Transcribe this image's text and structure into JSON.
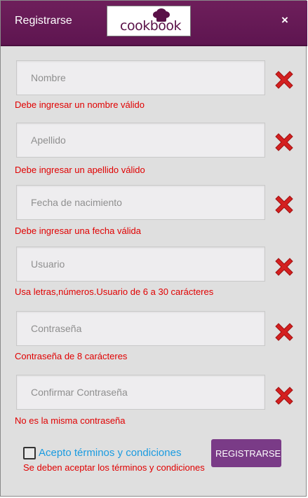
{
  "header": {
    "title": "Registrarse",
    "logo_text": "cookbook",
    "close_label": "×"
  },
  "fields": [
    {
      "placeholder": "Nombre",
      "error": "Debe ingresar un nombre válido"
    },
    {
      "placeholder": "Apellido",
      "error": "Debe ingresar un apellido válido"
    },
    {
      "placeholder": "Fecha de nacimiento",
      "error": "Debe ingresar una fecha válida"
    },
    {
      "placeholder": "Usuario",
      "error": "Usa letras,números.Usuario de 6 a 30 carácteres"
    },
    {
      "placeholder": "Contraseña",
      "error": "Contraseña de 8 carácteres"
    },
    {
      "placeholder": "Confirmar Contraseña",
      "error": "No es la misma contraseña"
    }
  ],
  "terms": {
    "label": "Acepto términos y condiciones",
    "error": "Se deben aceptar los términos y condiciones",
    "checked": false
  },
  "register_button": "REGISTRARSE",
  "colors": {
    "header_bg": "#6e1f5b",
    "button_bg": "#7a3b87",
    "error_text": "#e00000",
    "error_icon": "#d42020",
    "link_text": "#1a9be0"
  }
}
